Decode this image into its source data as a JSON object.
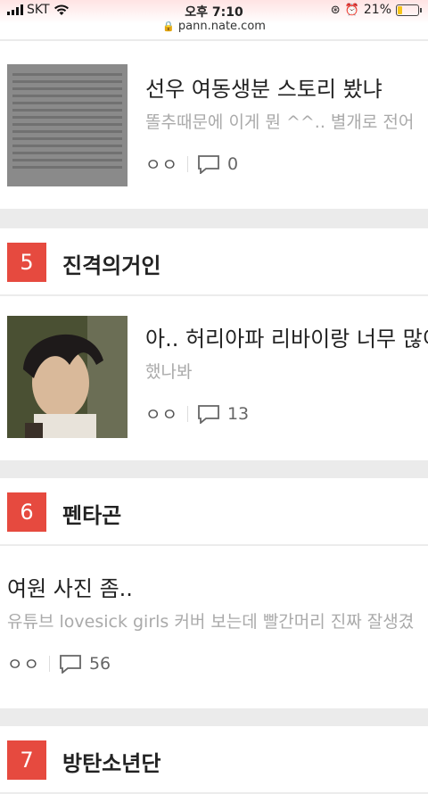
{
  "status": {
    "carrier": "SKT",
    "time": "오후 7:10",
    "battery": "21%",
    "url": "pann.nate.com"
  },
  "posts": [
    {
      "title": "선우 여동생분 스토리 봤냐",
      "snippet": "똘추때문에 이게 뭔 ^^.. 별개로 전어",
      "oo": "ㅇㅇ",
      "comments": "0"
    },
    {
      "rank": "5",
      "board": "진격의거인",
      "title": "아.. 허리아파 리바이랑 너무 많이",
      "snippet": "했나봐",
      "oo": "ㅇㅇ",
      "comments": "13"
    },
    {
      "rank": "6",
      "board": "펜타곤",
      "title": "여원 사진 좀..",
      "snippet": "유튜브 lovesick girls 커버 보는데 빨간머리 진짜 잘생겼",
      "oo": "ㅇㅇ",
      "comments": "56"
    },
    {
      "rank": "7",
      "board": "방탄소년단"
    }
  ],
  "icons": {
    "lock": "lock-icon",
    "wifi": "wifi-icon",
    "comment": "comment-icon",
    "alarm": "alarm-icon"
  },
  "colors": {
    "rank_bg": "#e64a3f",
    "snippet": "#aaaaaa"
  }
}
